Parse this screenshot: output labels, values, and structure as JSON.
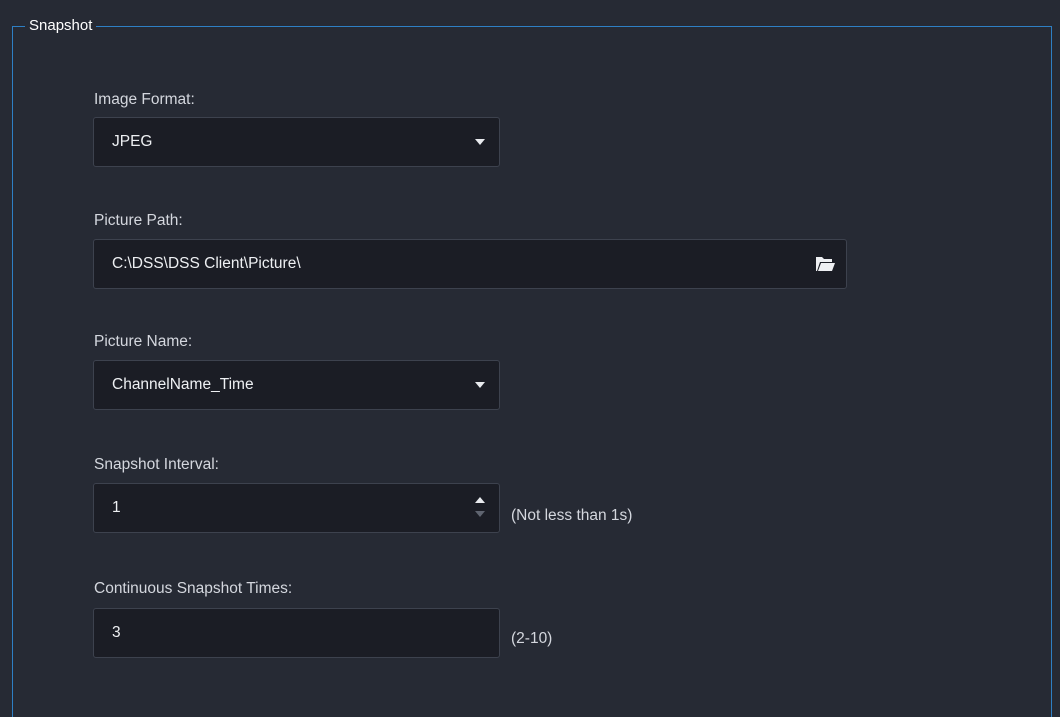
{
  "group": {
    "title": "Snapshot"
  },
  "image_format": {
    "label": "Image Format:",
    "value": "JPEG",
    "icon": "chevron-down-icon"
  },
  "picture_path": {
    "label": "Picture Path:",
    "value": "C:\\DSS\\DSS Client\\Picture\\",
    "icon": "folder-open-icon"
  },
  "picture_name": {
    "label": "Picture Name:",
    "value": "ChannelName_Time",
    "icon": "chevron-down-icon"
  },
  "snapshot_interval": {
    "label": "Snapshot Interval:",
    "value": "1",
    "hint": "(Not less than 1s)",
    "icons": [
      "spin-up-icon",
      "spin-down-icon"
    ]
  },
  "continuous_times": {
    "label": "Continuous Snapshot Times:",
    "value": "3",
    "hint": "(2-10)"
  },
  "colors": {
    "background": "#262a34",
    "field_background": "#1b1d25",
    "field_border": "#3d424e",
    "accent_border": "#2e7fc4",
    "text": "#d4d7de"
  }
}
